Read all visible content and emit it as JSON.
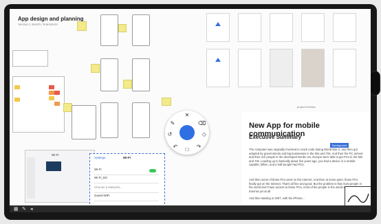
{
  "board": {
    "title": "App design and planning",
    "subtitle": "Version 1 sketch / brainstorm"
  },
  "canvas_label": "project timeline",
  "document": {
    "heading": "New App for mobile communication",
    "subheading": "Executive Summary",
    "highlight": "Background",
    "paragraphs": [
      "The computer was originally invented to crack code during World War II, and then got adopted by governments and big businesses in the 50s and 70s. And then the PC arrived and then rich people in the developed Nordic US, Europe were able to get PCs in the 90s and 70s. Leading up to basically about five years ago, you had a device in a mobile-capable, billion, and a half-people had PCs.",
      "And then some of those PCs went on the Internet. And then at some point, those PCs finally got on the Internet. That's all fine and good. But the problem is that most people in the world don't have access to those PCs, most of the people in the world aren't on the Internet yet at all.",
      "And then starting in 2007, with the iPhone..."
    ]
  },
  "tablet": {
    "panel_title": "Wi-Fi",
    "back_label": "Settings",
    "settings_title": "Wi-Fi",
    "rows": [
      "Wi-Fi",
      "Wi-Fi_5G",
      "Choose a Network...",
      "Guest-WiFi"
    ]
  },
  "wheel": {
    "center": "●"
  },
  "icons": [
    "pen-icon",
    "eraser-icon",
    "shape-icon",
    "lasso-icon",
    "close-icon",
    "menu-icon",
    "undo-icon",
    "redo-icon"
  ],
  "colors": {
    "accent": "#2f6fe4",
    "sticky": "#f3ea8a",
    "toggle_on": "#3cc757"
  }
}
